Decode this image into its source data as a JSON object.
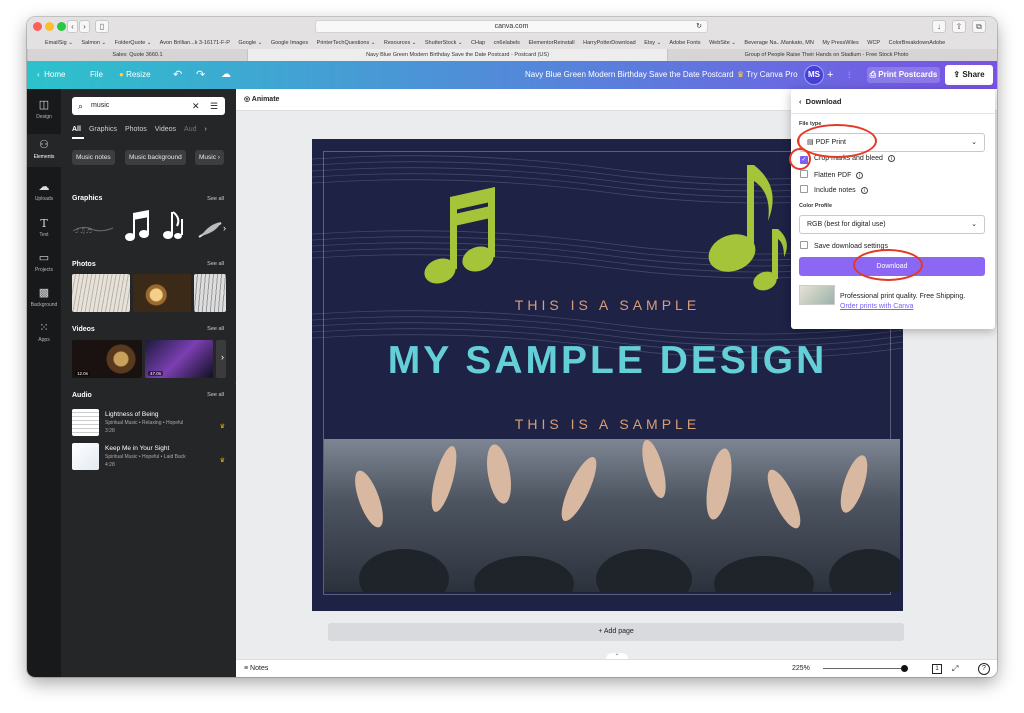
{
  "browser": {
    "url": "canva.com",
    "bookmarks": [
      "EmailSig ⌄",
      "Salmon ⌄",
      "FolderQuote ⌄",
      "Avon Brillian...k 3-16171-F-P",
      "Google ⌄",
      "Google Images",
      "PrinterTechQuestions ⌄",
      "Resources ⌄",
      "ShutterStock ⌄",
      "CHap",
      "cn6elabels",
      "ElementorReinstall",
      "HarryPotterDownload",
      "Etsy ⌄",
      "Adobe Fonts",
      "WebSite ⌄",
      "Beverage Na...Mankato, MN",
      "My PressWiles",
      "WCP",
      "ColorBreakdownAdobe"
    ],
    "tabs": [
      "Sales: Quote 3660.1",
      "Navy Blue Green Modern Birthday Save the Date Postcard - Postcard (US)",
      "Group of People Raise Their Hands on Stadium - Free Stock Photo"
    ]
  },
  "topbar": {
    "home": "Home",
    "file": "File",
    "resize": "Resize",
    "title": "Navy Blue Green Modern Birthday Save the Date Postcard",
    "try_pro": "Try Canva Pro",
    "avatar": "MS",
    "print": "Print Postcards",
    "share": "Share"
  },
  "rail": [
    "Design",
    "Elements",
    "Uploads",
    "Text",
    "Projects",
    "Background",
    "Apps"
  ],
  "panel": {
    "search_value": "music",
    "tabs": [
      "All",
      "Graphics",
      "Photos",
      "Videos",
      "Aud"
    ],
    "chips": [
      "Music notes",
      "Music background",
      "Music"
    ],
    "graphics_label": "Graphics",
    "photos_label": "Photos",
    "videos_label": "Videos",
    "audio_label": "Audio",
    "see_all": "See all",
    "video_durations": [
      "12.0s",
      "47.0s"
    ],
    "audio": [
      {
        "title": "Lightness of Being",
        "meta": "Spiritual Music • Relaxing • Hopeful",
        "duration": "3:28"
      },
      {
        "title": "Keep Me in Your Sight",
        "meta": "Spiritual Music • Hopeful • Laid Back",
        "duration": "4:28"
      }
    ]
  },
  "workspace": {
    "animate": "Animate",
    "add_page": "+ Add page",
    "notes": "Notes",
    "zoom": "225%",
    "page_count": "1"
  },
  "design": {
    "line1": "THIS IS A SAMPLE",
    "title": "MY SAMPLE DESIGN",
    "line2": "THIS IS A SAMPLE"
  },
  "download": {
    "heading": "Download",
    "file_type_label": "File type",
    "file_type": "PDF Print",
    "crop_marks": "Crop marks and bleed",
    "flatten": "Flatten PDF",
    "include_notes": "Include notes",
    "color_profile_label": "Color Profile",
    "color_profile": "RGB (best for digital use)",
    "save_settings": "Save download settings",
    "button": "Download",
    "promo": "Professional print quality. Free Shipping.",
    "promo_link": "Order prints with Canva"
  },
  "colors": {
    "accent": "#8b67f4",
    "annotation": "#e33a26",
    "canvas_bg": "#1e2245",
    "title_color": "#65cfd8",
    "note_green": "#a6c43a"
  }
}
